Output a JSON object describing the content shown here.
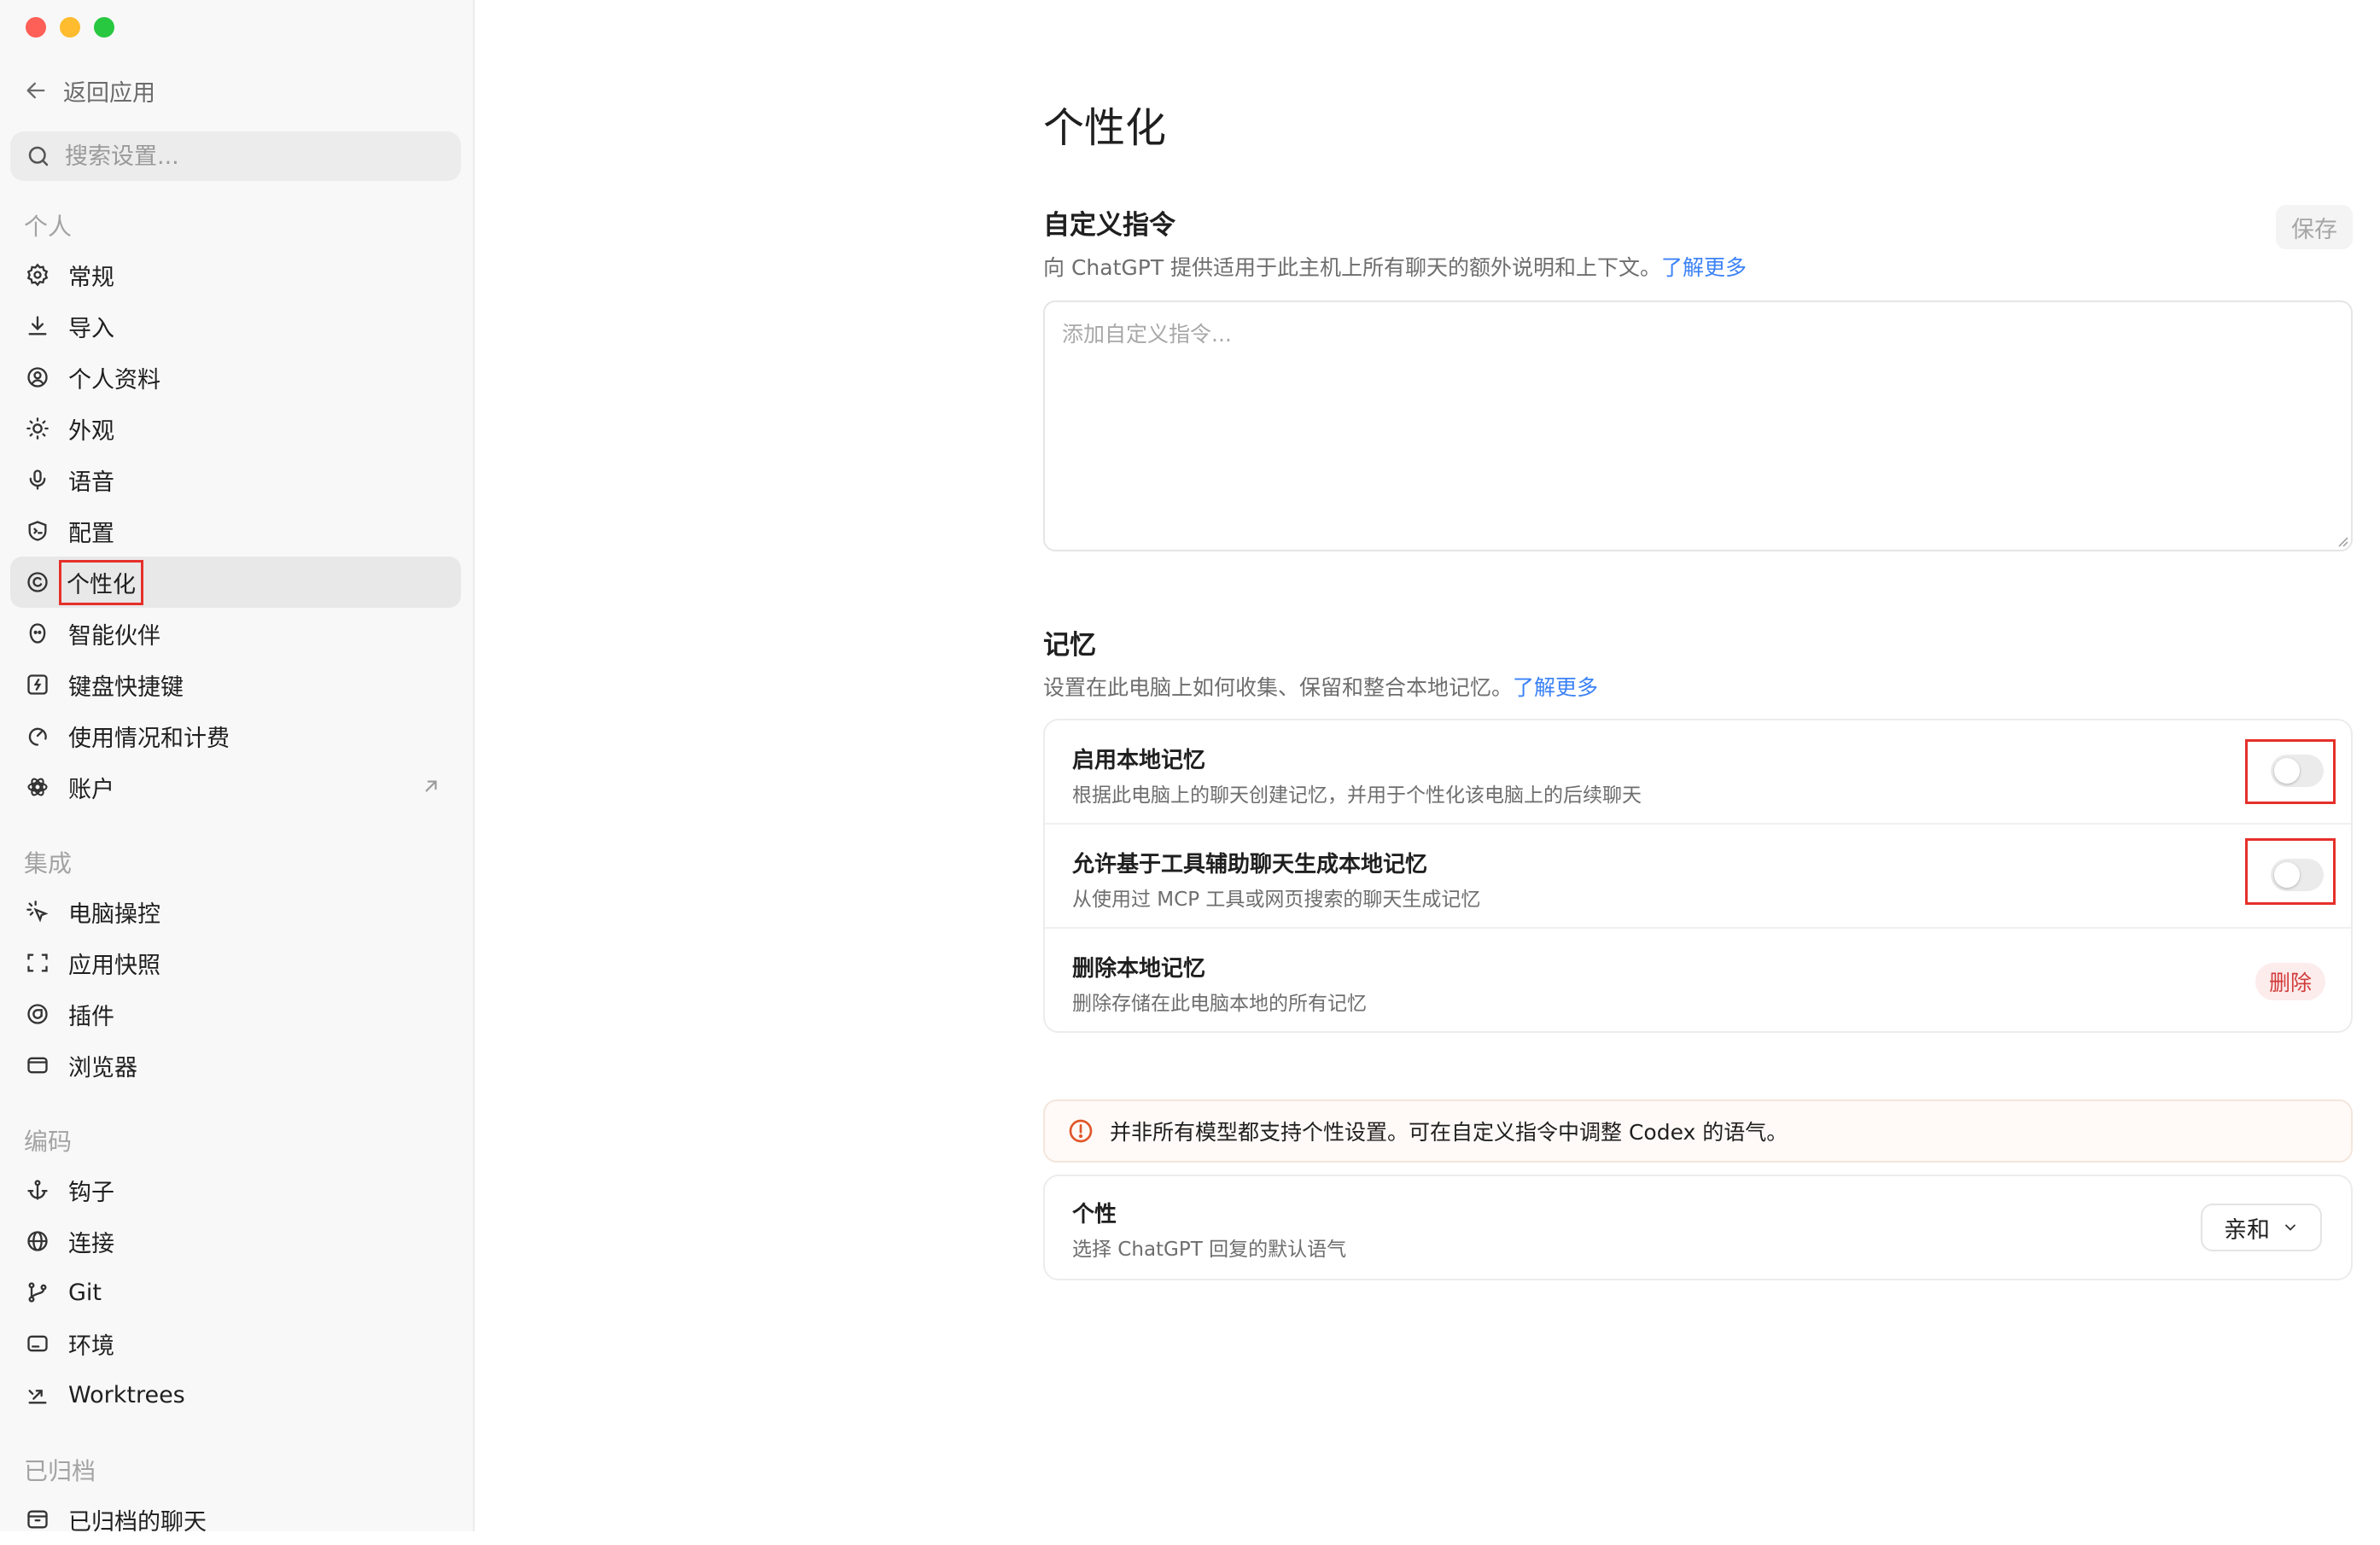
{
  "sidebar": {
    "back_label": "返回应用",
    "search_placeholder": "搜索设置...",
    "groups": [
      {
        "title": "个人",
        "items": [
          {
            "label": "常规",
            "icon": "gear-icon"
          },
          {
            "label": "导入",
            "icon": "download-icon"
          },
          {
            "label": "个人资料",
            "icon": "profile-icon"
          },
          {
            "label": "外观",
            "icon": "sun-icon"
          },
          {
            "label": "语音",
            "icon": "mic-icon"
          },
          {
            "label": "配置",
            "icon": "config-icon"
          },
          {
            "label": "个性化",
            "icon": "smile-icon",
            "active": true
          },
          {
            "label": "智能伙伴",
            "icon": "companion-icon"
          },
          {
            "label": "键盘快捷键",
            "icon": "keyboard-icon"
          },
          {
            "label": "使用情况和计费",
            "icon": "gauge-icon"
          },
          {
            "label": "账户",
            "icon": "openai-icon",
            "external": true
          }
        ]
      },
      {
        "title": "集成",
        "items": [
          {
            "label": "电脑操控",
            "icon": "pointer-icon"
          },
          {
            "label": "应用快照",
            "icon": "snapshot-icon"
          },
          {
            "label": "插件",
            "icon": "plugin-icon"
          },
          {
            "label": "浏览器",
            "icon": "browser-icon"
          }
        ]
      },
      {
        "title": "编码",
        "items": [
          {
            "label": "钩子",
            "icon": "anchor-icon"
          },
          {
            "label": "连接",
            "icon": "globe-icon"
          },
          {
            "label": "Git",
            "icon": "git-branch-icon"
          },
          {
            "label": "环境",
            "icon": "environment-icon"
          },
          {
            "label": "Worktrees",
            "icon": "worktree-icon"
          }
        ]
      },
      {
        "title": "已归档",
        "items": [
          {
            "label": "已归档的聊天",
            "icon": "archive-icon"
          }
        ]
      }
    ]
  },
  "main": {
    "title": "个性化",
    "custom": {
      "title": "自定义指令",
      "desc": "向 ChatGPT 提供适用于此主机上所有聊天的额外说明和上下文。",
      "learn_more": "了解更多",
      "save_label": "保存",
      "placeholder": "添加自定义指令..."
    },
    "memory": {
      "title": "记忆",
      "desc": "设置在此电脑上如何收集、保留和整合本地记忆。",
      "learn_more": "了解更多",
      "rows": [
        {
          "title": "启用本地记忆",
          "desc": "根据此电脑上的聊天创建记忆，并用于个性化该电脑上的后续聊天",
          "enabled": false
        },
        {
          "title": "允许基于工具辅助聊天生成本地记忆",
          "desc": "从使用过 MCP 工具或网页搜索的聊天生成记忆",
          "enabled": false
        },
        {
          "title": "删除本地记忆",
          "desc": "删除存储在此电脑本地的所有记忆",
          "button": "删除"
        }
      ]
    },
    "notice": "并非所有模型都支持个性设置。可在自定义指令中调整 Codex 的语气。",
    "personality": {
      "title": "个性",
      "desc": "选择 ChatGPT 回复的默认语气",
      "value": "亲和"
    }
  },
  "colors": {
    "accent_link": "#3b82f6",
    "highlight_box": "#e5302a",
    "danger": "#d23b3b",
    "notice_icon": "#e0562a"
  }
}
